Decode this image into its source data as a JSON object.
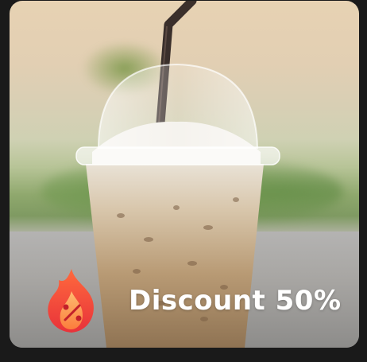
{
  "promo": {
    "label": "Discount 50%",
    "image_subject": "iced-coffee-icon",
    "badge_icon": "fire-discount-icon",
    "colors": {
      "badge_top": "#ff6a3d",
      "badge_bottom": "#e8323a",
      "badge_inner": "#ffb05a",
      "text": "#ffffff"
    }
  }
}
